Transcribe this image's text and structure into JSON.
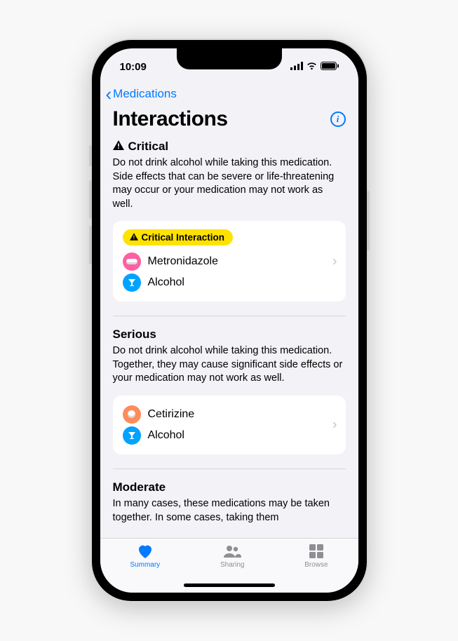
{
  "status": {
    "time": "10:09"
  },
  "nav": {
    "back_label": "Medications"
  },
  "header": {
    "title": "Interactions"
  },
  "sections": {
    "critical": {
      "label": "Critical",
      "desc": "Do not drink alcohol while taking this medication. Side effects that can be severe or life-threatening may occur or your medication may not work as well.",
      "badge": "Critical Interaction",
      "med1": "Metronidazole",
      "med2": "Alcohol"
    },
    "serious": {
      "label": "Serious",
      "desc": "Do not drink alcohol while taking this medication. Together, they may cause significant side effects or your medication may not work as well.",
      "med1": "Cetirizine",
      "med2": "Alcohol"
    },
    "moderate": {
      "label": "Moderate",
      "desc": "In many cases, these medications may be taken together. In some cases, taking them"
    }
  },
  "tabs": {
    "summary": "Summary",
    "sharing": "Sharing",
    "browse": "Browse"
  }
}
